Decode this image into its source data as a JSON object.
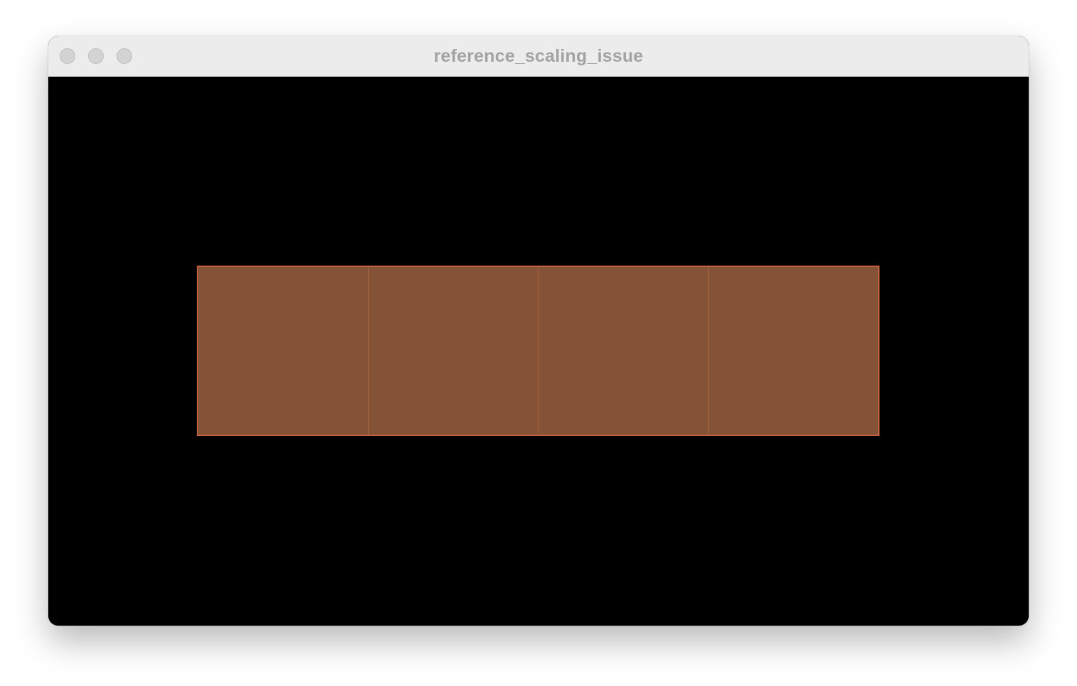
{
  "window": {
    "title": "reference_scaling_issue"
  },
  "scene": {
    "background_color": "#000000",
    "tiles": [
      {
        "fill": "#845236"
      },
      {
        "fill": "#845236"
      },
      {
        "fill": "#845236"
      },
      {
        "fill": "#845236"
      }
    ],
    "outline_color": "#c0603e"
  },
  "icons": {
    "close": "close-button-icon",
    "minimize": "minimize-button-icon",
    "zoom": "zoom-button-icon"
  }
}
